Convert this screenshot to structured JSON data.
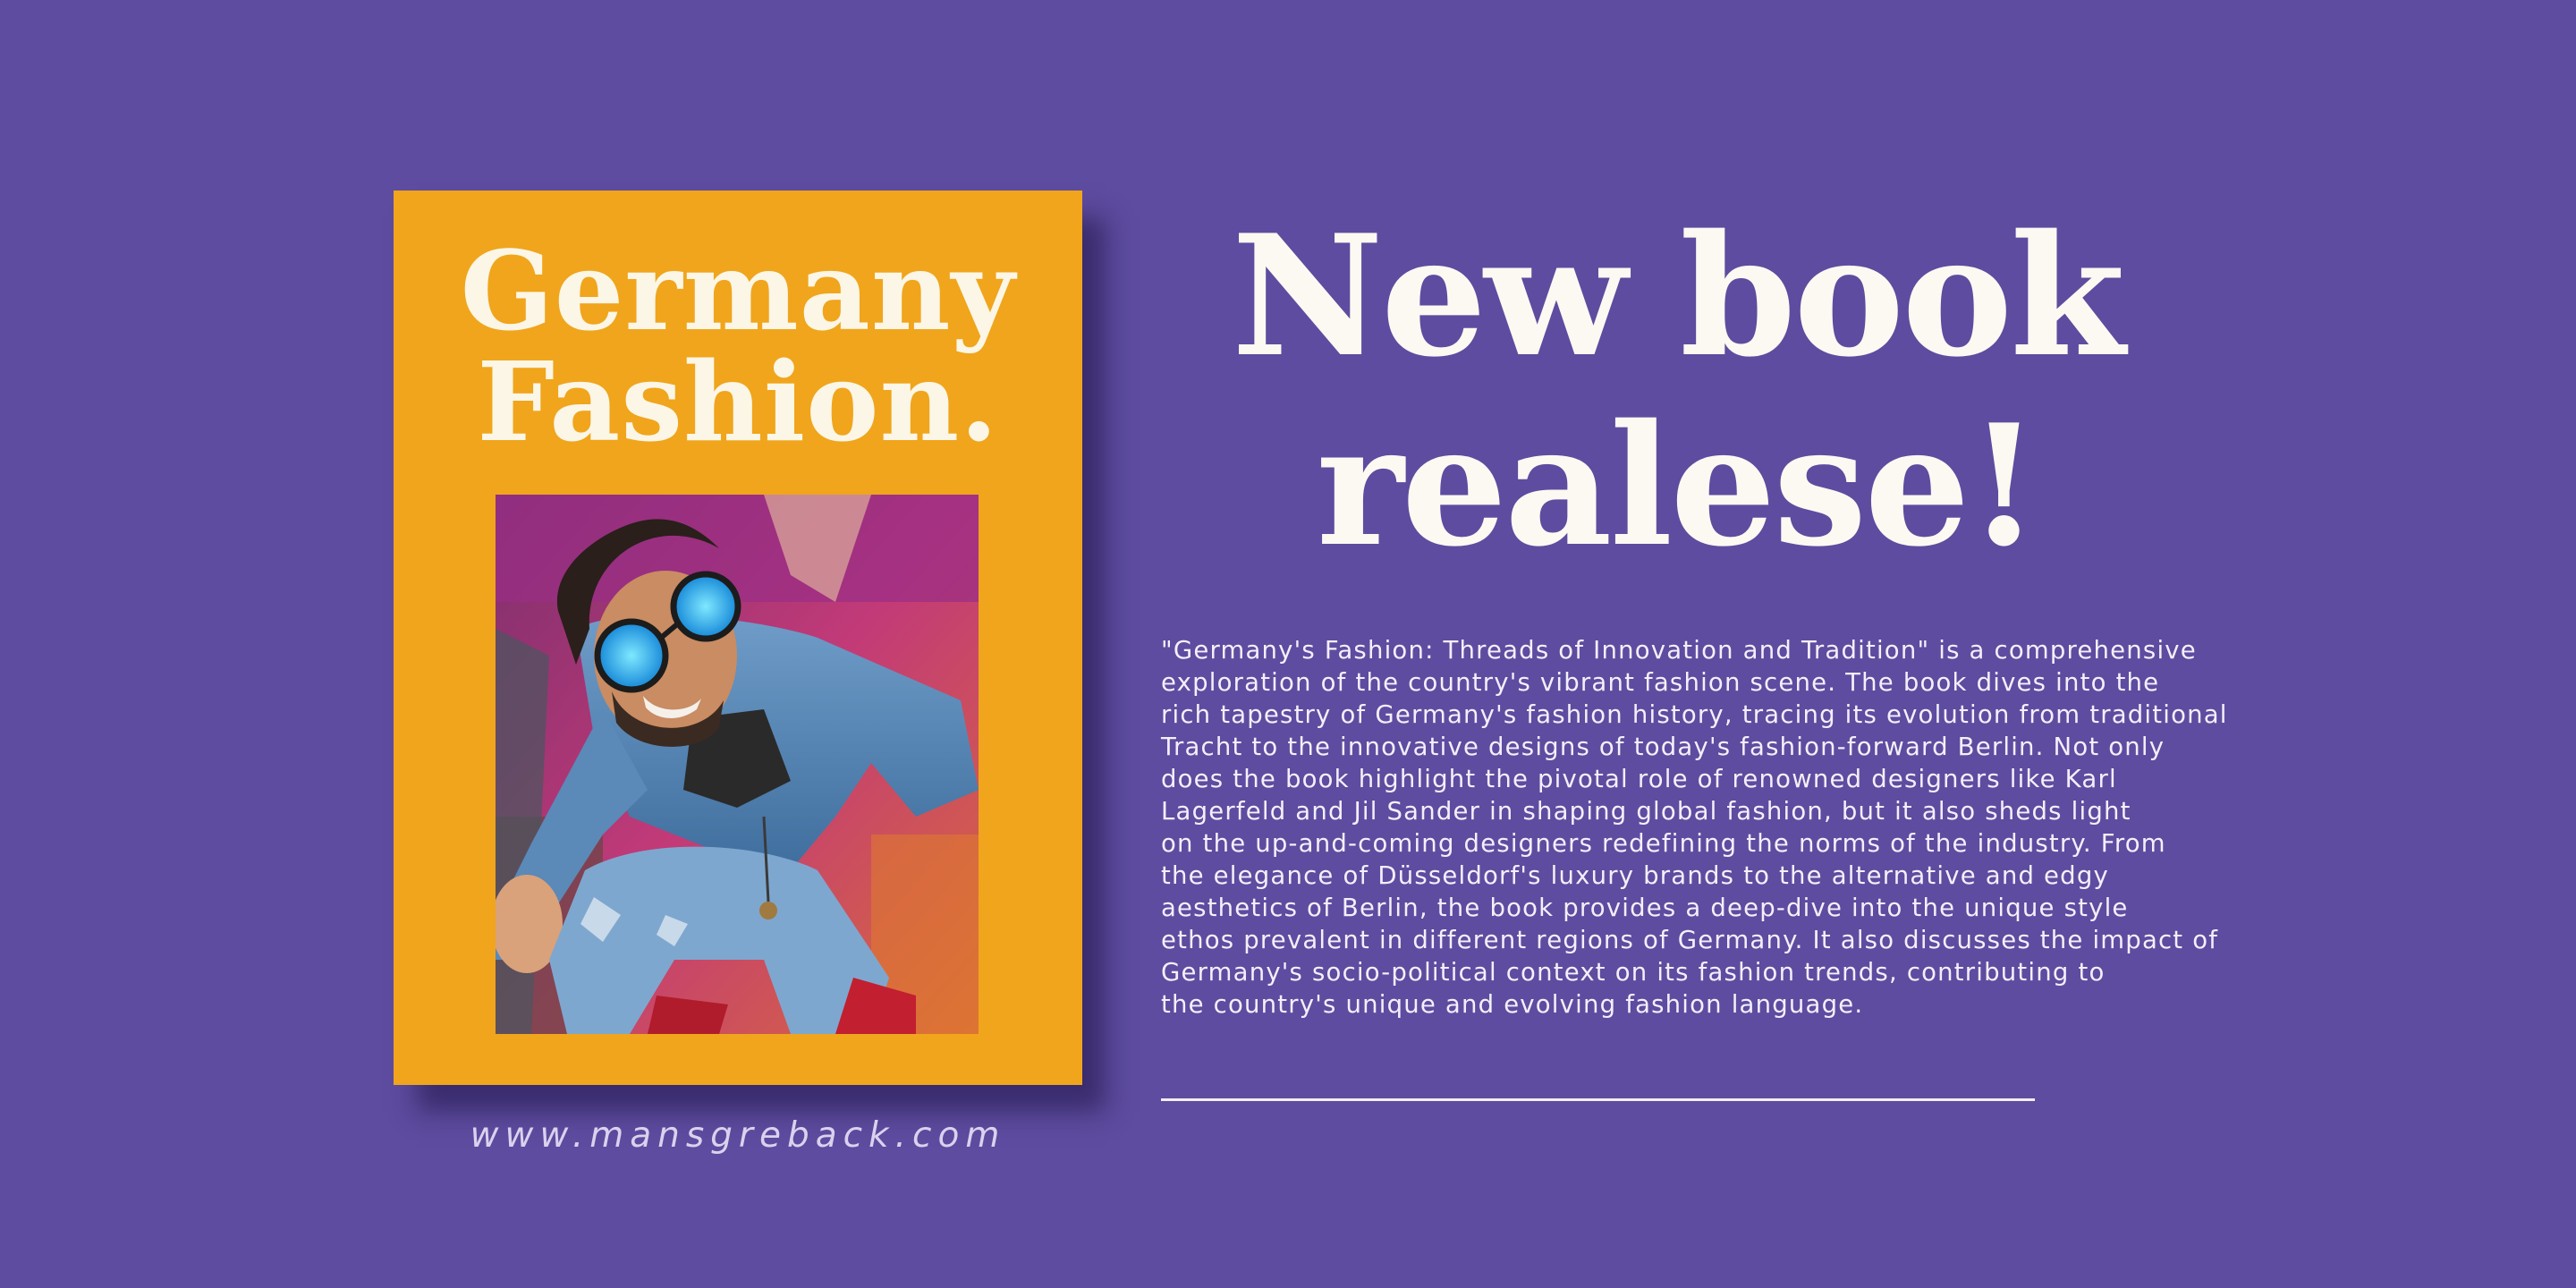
{
  "book": {
    "title_lines": [
      "Germany",
      "Fashion."
    ],
    "photo_icon": "man-with-blue-sunglasses-photo"
  },
  "website": "www.mansgreback.com",
  "headline_lines": [
    "New book",
    "realese!"
  ],
  "description_lines": [
    "\"Germany's Fashion: Threads of Innovation and Tradition\" is a comprehensive",
    "exploration of the country's vibrant fashion scene. The book dives into the",
    "rich tapestry of Germany's fashion history, tracing its evolution from traditional",
    "Tracht to the innovative designs of today's fashion-forward Berlin. Not only",
    "does the book highlight the pivotal role of renowned designers like Karl",
    "Lagerfeld and Jil Sander in shaping global fashion, but it also sheds light",
    "on the up-and-coming designers redefining the norms of the industry. From",
    "the elegance of Düsseldorf's luxury brands to the alternative and edgy",
    "aesthetics of Berlin, the book provides a deep-dive into the unique style",
    "ethos prevalent in different regions of Germany. It also discusses the impact of",
    "Germany's socio-political context on its fashion trends, contributing to",
    "the country's unique and evolving fashion language."
  ],
  "colors": {
    "background": "#5d4c9f",
    "book_cover": "#f0a51c",
    "text": "#fbf9f2"
  }
}
